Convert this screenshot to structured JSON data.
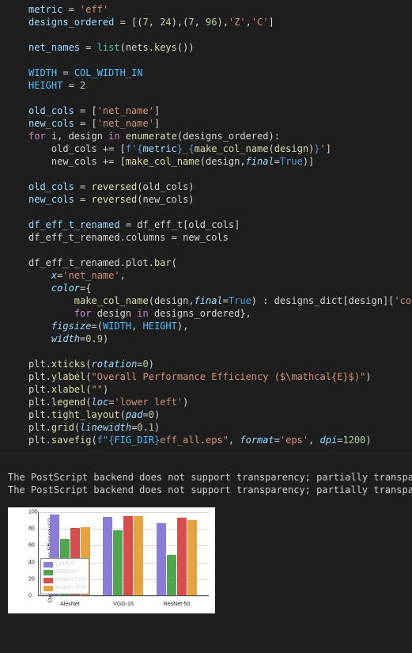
{
  "code": {
    "l1_metric_key": "metric",
    "l1_eq": " = ",
    "l1_val": "'eff'",
    "l2_var": "designs_ordered",
    "l2_eq": " = [(",
    "l2_n1": "7",
    "l2_c1": ", ",
    "l2_n2": "24",
    "l2_c2": "),(",
    "l2_n3": "7",
    "l2_c3": ", ",
    "l2_n4": "96",
    "l2_c4": "),",
    "l2_s1": "'Z'",
    "l2_c5": ",",
    "l2_s2": "'C'",
    "l2_end": "]",
    "l4_var": "net_names",
    "l4_eq": " = ",
    "l4_fn": "list",
    "l4_p": "(nets.",
    "l4_fn2": "keys",
    "l4_p2": "())",
    "l6_var": "WIDTH",
    "l6_eq": " = ",
    "l6_val": "COL_WIDTH_IN",
    "l7_var": "HEIGHT",
    "l7_eq": " = ",
    "l7_val": "2",
    "l9_var": "old_cols",
    "l9_eq": " = [",
    "l9_val": "'net_name'",
    "l9_end": "]",
    "l10_var": "new_cols",
    "l10_eq": " = [",
    "l10_val": "'net_name'",
    "l10_end": "]",
    "l11_for": "for",
    "l11_sp1": " i, design ",
    "l11_in": "in",
    "l11_sp2": " ",
    "l11_fn": "enumerate",
    "l11_p": "(designs_ordered):",
    "l12_ind": "    old_cols += [",
    "l12_f": "f'",
    "l12_brace1": "{",
    "l12_v1": "metric",
    "l12_brace2": "}",
    "l12_mid": "_",
    "l12_brace3": "{",
    "l12_fn": "make_col_name(design)",
    "l12_brace4": "}",
    "l12_fend": "'",
    "l12_end": "]",
    "l13_ind": "    new_cols += [",
    "l13_fn": "make_col_name",
    "l13_args": "(design,",
    "l13_param": "final",
    "l13_eq": "=",
    "l13_true": "True",
    "l13_end": ")]",
    "l15_var": "old_cols",
    "l15_eq": " = ",
    "l15_fn": "reversed",
    "l15_p": "(old_cols)",
    "l16_var": "new_cols",
    "l16_eq": " = ",
    "l16_fn": "reversed",
    "l16_p": "(new_cols)",
    "l18_var": "df_eff_t_renamed",
    "l18_eq": " = df_eff_t[old_cols]",
    "l19_txt": "df_eff_t_renamed.columns = new_cols",
    "l21_txt": "df_eff_t_renamed.plot.",
    "l21_fn": "bar",
    "l21_p": "(",
    "l22_ind": "    ",
    "l22_p": "x",
    "l22_eq": "=",
    "l22_v": "'net_name'",
    "l22_c": ",",
    "l23_ind": "    ",
    "l23_p": "color",
    "l23_eq": "={",
    "l24_ind": "        ",
    "l24_fn": "make_col_name",
    "l24_args": "(design,",
    "l24_p": "final",
    "l24_eq": "=",
    "l24_true": "True",
    "l24_mid": ") : designs_dict[design][",
    "l24_s": "'color'",
    "l24_end": "]",
    "l25_ind": "        ",
    "l25_for": "for",
    "l25_txt": " design ",
    "l25_in": "in",
    "l25_end": " designs_ordered},",
    "l26_ind": "    ",
    "l26_p": "figsize",
    "l26_eq": "=(",
    "l26_v1": "WIDTH",
    "l26_c": ", ",
    "l26_v2": "HEIGHT",
    "l26_end": "),",
    "l27_ind": "    ",
    "l27_p": "width",
    "l27_eq": "=",
    "l27_v": "0.9",
    "l27_end": ")",
    "l29_txt": "plt.",
    "l29_fn": "xticks",
    "l29_p": "(",
    "l29_param": "rotation",
    "l29_eq": "=",
    "l29_v": "0",
    "l29_end": ")",
    "l30_txt": "plt.",
    "l30_fn": "ylabel",
    "l30_p": "(",
    "l30_s": "\"Overall Performance Efficiency ($\\mathcal{E}$)\"",
    "l30_end": ")",
    "l31_txt": "plt.",
    "l31_fn": "xlabel",
    "l31_p": "(",
    "l31_s": "\"\"",
    "l31_end": ")",
    "l32_txt": "plt.",
    "l32_fn": "legend",
    "l32_p": "(",
    "l32_param": "loc",
    "l32_eq": "=",
    "l32_s": "'lower left'",
    "l32_end": ")",
    "l33_txt": "plt.",
    "l33_fn": "tight_layout",
    "l33_p": "(",
    "l33_param": "pad",
    "l33_eq": "=",
    "l33_v": "0",
    "l33_end": ")",
    "l34_txt": "plt.",
    "l34_fn": "grid",
    "l34_p": "(",
    "l34_param": "linewidth",
    "l34_eq": "=",
    "l34_v": "0.1",
    "l34_end": ")",
    "l35_txt": "plt.",
    "l35_fn": "savefig",
    "l35_p": "(",
    "l35_f": "f\"",
    "l35_brace1": "{",
    "l35_v": "FIG_DIR",
    "l35_brace2": "}",
    "l35_rest": "eff_all.eps\"",
    "l35_c": ", ",
    "l35_p1": "format",
    "l35_eq1": "=",
    "l35_s1": "'eps'",
    "l35_c2": ", ",
    "l35_p2": "dpi",
    "l35_eq2": "=",
    "l35_v2": "1200",
    "l35_end": ")"
  },
  "output": {
    "warn1": "The PostScript backend does not support transparency; partially transparent",
    "warn2": "The PostScript backend does not support transparency; partially transparent"
  },
  "chart_data": {
    "type": "bar",
    "title": "",
    "xlabel": "",
    "ylabel": "Overall Performance Efficiency (ℰ)",
    "categories": [
      "AlexNet",
      "VGG-16",
      "ResNet-50"
    ],
    "series": [
      {
        "name": "CARLA",
        "color": "#8c7cd8",
        "values": [
          96,
          93,
          86
        ]
      },
      {
        "name": "ZASCAD",
        "color": "#4fa64f",
        "values": [
          67,
          77,
          48
        ]
      },
      {
        "name": "Kraken 7x96",
        "color": "#d84e4e",
        "values": [
          80,
          94,
          92
        ]
      },
      {
        "name": "Kraken 7x24",
        "color": "#e6a23c",
        "values": [
          81,
          94,
          90
        ]
      }
    ],
    "ylim": [
      0,
      100
    ],
    "yticks": [
      0,
      20,
      40,
      60,
      80,
      100
    ],
    "legend_loc": "lower left",
    "grid": true
  }
}
